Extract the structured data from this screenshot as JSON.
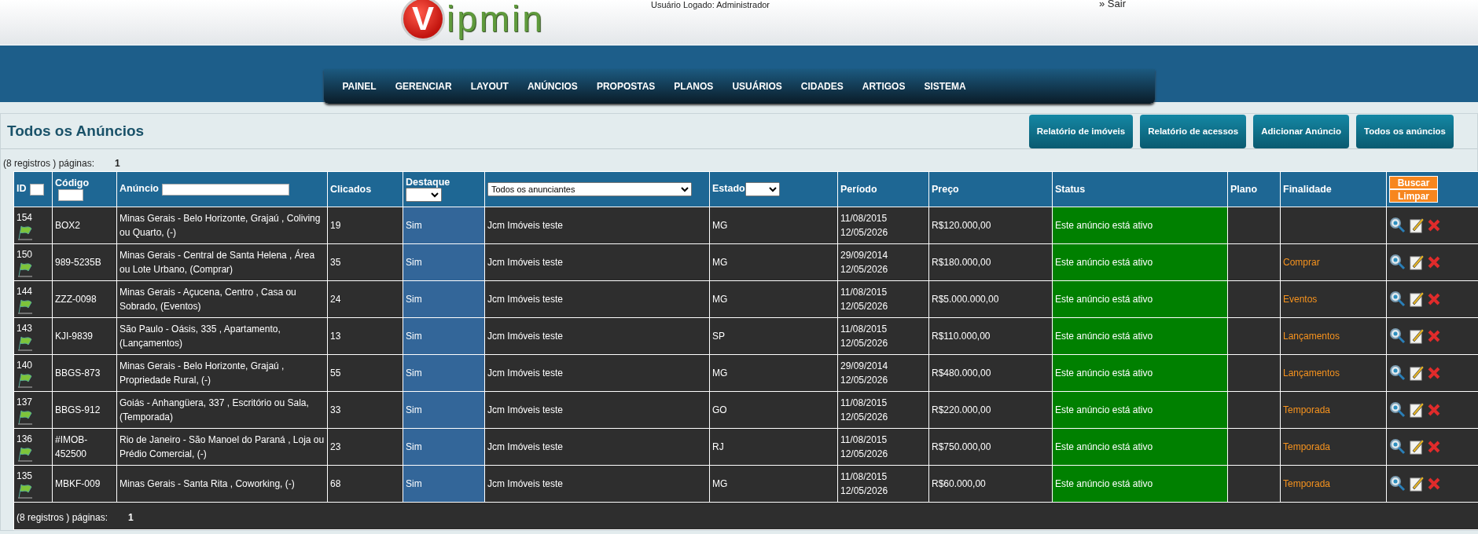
{
  "header": {
    "logo": {
      "letter": "V",
      "text": "ipmin"
    },
    "user_label": "Usuário Logado: Administrador",
    "logout": {
      "marker": "»",
      "label": "Sair"
    }
  },
  "nav": [
    "PAINEL",
    "GERENCIAR",
    "LAYOUT",
    "ANÚNCIOS",
    "PROPOSTAS",
    "PLANOS",
    "USUÁRIOS",
    "CIDADES",
    "ARTIGOS",
    "SISTEMA"
  ],
  "page": {
    "title": "Todos os Anúncios",
    "actions": [
      "Relatório de imóveis",
      "Relatório de acessos",
      "Adicionar Anúncio",
      "Todos os anúncios"
    ]
  },
  "pagination_top": {
    "label": "(8 registros ) páginas:",
    "page": "1"
  },
  "table": {
    "columns": [
      {
        "label": "ID",
        "kind": "input"
      },
      {
        "label": "Código",
        "kind": "input"
      },
      {
        "label": "Anúncio",
        "kind": "input"
      },
      {
        "label": "Clicados",
        "kind": "plain"
      },
      {
        "label": "Destaque",
        "kind": "select"
      },
      {
        "kind": "select",
        "value": "Todos os anunciantes"
      },
      {
        "label": "Estado",
        "kind": "select"
      },
      {
        "label": "Período",
        "kind": "plain"
      },
      {
        "label": "Preço",
        "kind": "plain"
      },
      {
        "label": "Status",
        "kind": "plain"
      },
      {
        "label": "Plano",
        "kind": "plain"
      },
      {
        "label": "Finalidade",
        "kind": "plain"
      }
    ],
    "search_buttons": [
      "Buscar",
      "Limpar"
    ],
    "rows": [
      {
        "id": "154",
        "code": "BOX2",
        "title": "Minas Gerais - Belo Horizonte, Grajaú , Coliving ou Quarto, (-)",
        "clicks": "19",
        "featured": "Sim",
        "advertiser": "Jcm Imóveis teste",
        "state": "MG",
        "start": "11/08/2015",
        "end": "12/05/2026",
        "price": "R$120.000,00",
        "status": "Este anúncio está ativo",
        "purpose": ""
      },
      {
        "id": "150",
        "code": "989-5235B",
        "title": "Minas Gerais - Central de Santa Helena , Área ou Lote Urbano, (Comprar)",
        "clicks": "35",
        "featured": "Sim",
        "advertiser": "Jcm Imóveis teste",
        "state": "MG",
        "start": "29/09/2014",
        "end": "12/05/2026",
        "price": "R$180.000,00",
        "status": "Este anúncio está ativo",
        "purpose": "Comprar"
      },
      {
        "id": "144",
        "code": "ZZZ-0098",
        "title": "Minas Gerais - Açucena, Centro , Casa ou Sobrado, (Eventos)",
        "clicks": "24",
        "featured": "Sim",
        "advertiser": "Jcm Imóveis teste",
        "state": "MG",
        "start": "11/08/2015",
        "end": "12/05/2026",
        "price": "R$5.000.000,00",
        "status": "Este anúncio está ativo",
        "purpose": "Eventos"
      },
      {
        "id": "143",
        "code": "KJI-9839",
        "title": "São Paulo - Oásis, 335 , Apartamento, (Lançamentos)",
        "clicks": "13",
        "featured": "Sim",
        "advertiser": "Jcm Imóveis teste",
        "state": "SP",
        "start": "11/08/2015",
        "end": "12/05/2026",
        "price": "R$110.000,00",
        "status": "Este anúncio está ativo",
        "purpose": "Lançamentos"
      },
      {
        "id": "140",
        "code": "BBGS-873",
        "title": "Minas Gerais - Belo Horizonte, Grajaú , Propriedade Rural, (-)",
        "clicks": "55",
        "featured": "Sim",
        "advertiser": "Jcm Imóveis teste",
        "state": "MG",
        "start": "29/09/2014",
        "end": "12/05/2026",
        "price": "R$480.000,00",
        "status": "Este anúncio está ativo",
        "purpose": "Lançamentos"
      },
      {
        "id": "137",
        "code": "BBGS-912",
        "title": "Goiás - Anhangüera, 337 , Escritório ou Sala, (Temporada)",
        "clicks": "33",
        "featured": "Sim",
        "advertiser": "Jcm Imóveis teste",
        "state": "GO",
        "start": "11/08/2015",
        "end": "12/05/2026",
        "price": "R$220.000,00",
        "status": "Este anúncio está ativo",
        "purpose": "Temporada"
      },
      {
        "id": "136",
        "code": "#IMOB-452500",
        "title": "Rio de Janeiro - São Manoel do Paraná , Loja ou Prédio Comercial, (-)",
        "clicks": "23",
        "featured": "Sim",
        "advertiser": "Jcm Imóveis teste",
        "state": "RJ",
        "start": "11/08/2015",
        "end": "12/05/2026",
        "price": "R$750.000,00",
        "status": "Este anúncio está ativo",
        "purpose": "Temporada"
      },
      {
        "id": "135",
        "code": "MBKF-009",
        "title": "Minas Gerais - Santa Rita , Coworking, (-)",
        "clicks": "68",
        "featured": "Sim",
        "advertiser": "Jcm Imóveis teste",
        "state": "MG",
        "start": "11/08/2015",
        "end": "12/05/2026",
        "price": "R$60.000,00",
        "status": "Este anúncio está ativo",
        "purpose": "Temporada"
      }
    ]
  },
  "pagination_bottom": {
    "label": "(8 registros ) páginas:",
    "page": "1"
  }
}
